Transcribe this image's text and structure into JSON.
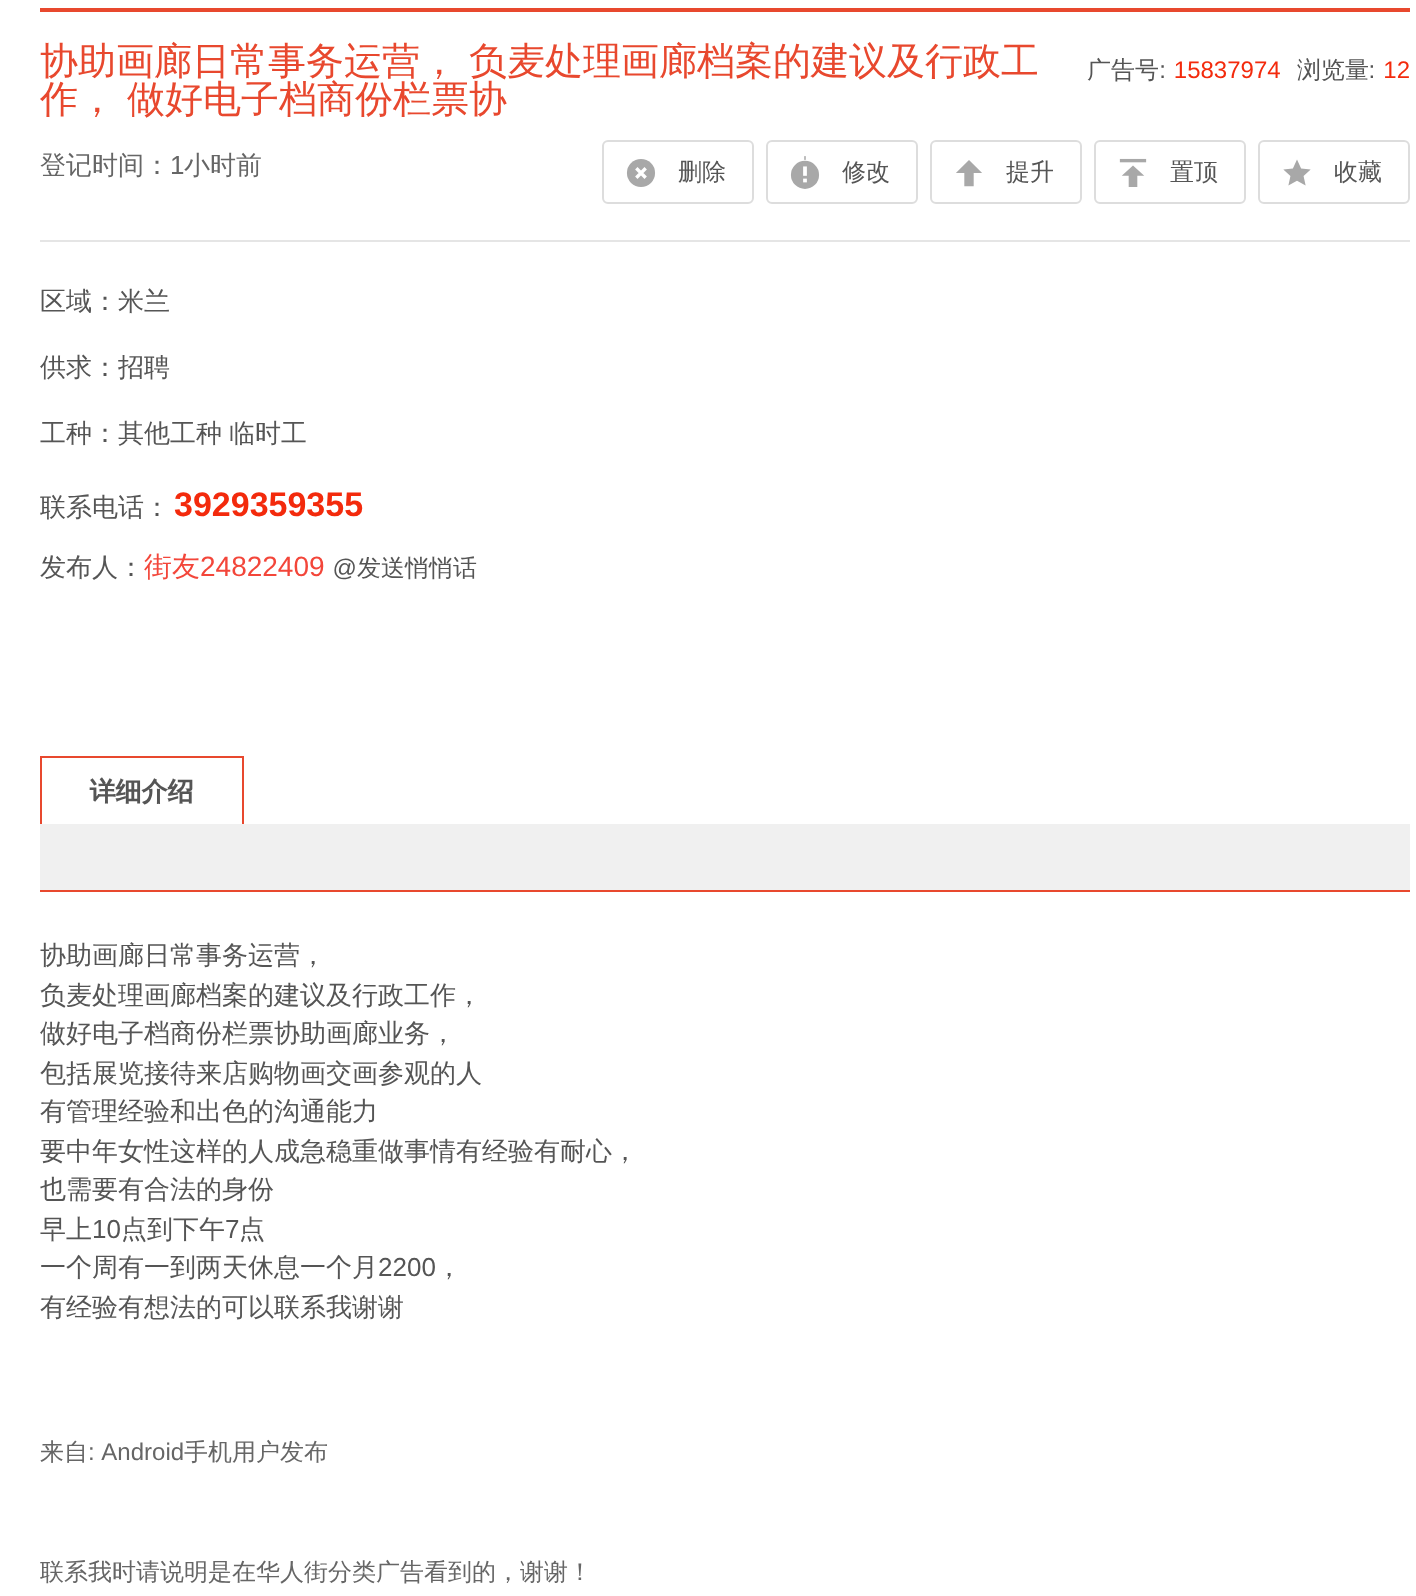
{
  "title": "协助画廊日常事务运营， 负麦处理画廊档案的建议及行政工作， 做好电子档商份栏票协",
  "meta": [
    {
      "label": "广告号:",
      "value": "15837974"
    },
    {
      "label": "浏览量:",
      "value": "12"
    }
  ],
  "posted": "登记时间：1小时前",
  "actions": [
    {
      "kind": "delete",
      "label": "删除"
    },
    {
      "kind": "edit",
      "label": "修改"
    },
    {
      "kind": "raise",
      "label": "提升"
    },
    {
      "kind": "pin",
      "label": "置顶"
    },
    {
      "kind": "favorite",
      "label": "收藏"
    }
  ],
  "fields": [
    {
      "kind": "text",
      "label": "区域：",
      "value": "米兰"
    },
    {
      "kind": "text",
      "label": "供求：",
      "value": "招聘"
    },
    {
      "kind": "text",
      "label": "工种：",
      "value": "其他工种 临时工"
    },
    {
      "kind": "phone",
      "label": "联系电话：",
      "value": "3929359355"
    },
    {
      "kind": "publisher",
      "label": "发布人：",
      "value": "街友24822409",
      "extra": "@发送悄悄话"
    }
  ],
  "tabs": [
    {
      "label": "详细介绍",
      "selected": true
    }
  ],
  "description": [
    "协助画廊日常事务运营，",
    "负麦处理画廊档案的建议及行政工作，",
    "做好电子档商份栏票协助画廊业务，",
    "包括展览接待来店购物画交画参观的人",
    "有管理经验和出色的沟通能力",
    "要中年女性这样的人成急稳重做事情有经验有耐心，",
    "也需要有合法的身份",
    "早上10点到下午7点",
    "一个周有一到两天休息一个月2200，",
    "有经验有想法的可以联系我谢谢"
  ],
  "source": "来自: Android手机用户发布",
  "notice": "联系我时请说明是在华人街分类广告看到的，谢谢！"
}
